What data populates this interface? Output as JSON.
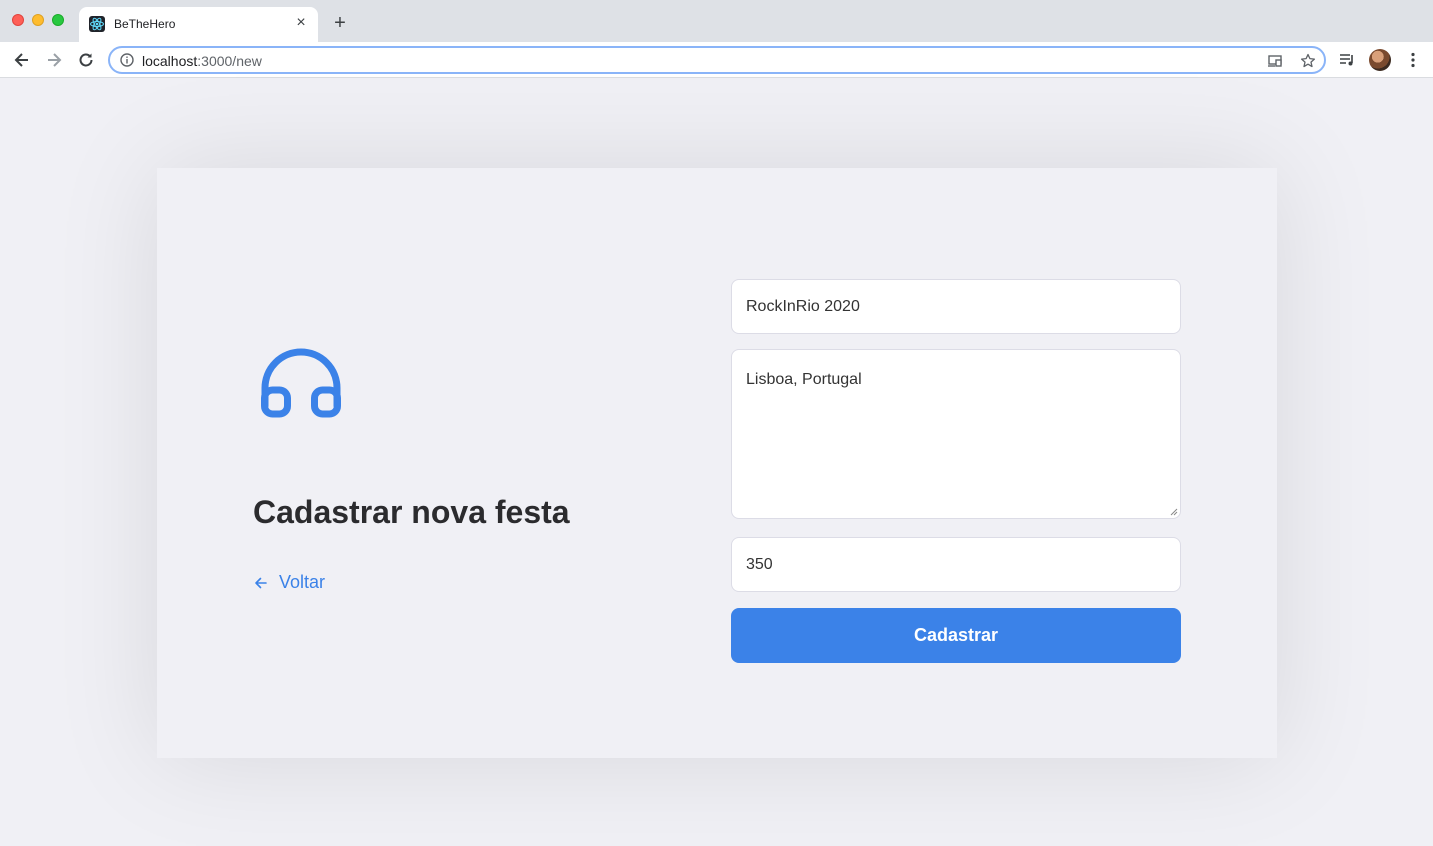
{
  "browser": {
    "tab_title": "BeTheHero",
    "tab_close": "×",
    "new_tab": "+",
    "url_host": "localhost",
    "url_path": ":3000/new",
    "icons": {
      "back": "back-arrow-icon",
      "forward": "forward-arrow-icon",
      "reload": "reload-icon",
      "info": "info-icon",
      "cast": "cast-icon",
      "bookmark": "star-icon",
      "media": "media-queue-icon",
      "menu": "kebab-menu-icon"
    }
  },
  "page": {
    "title": "Cadastrar nova festa",
    "back_label": "Voltar",
    "logo_icon": "headphones-icon",
    "accent_color": "#3b82e8",
    "form": {
      "name_value": "RockInRio 2020",
      "description_value": "Lisboa, Portugal",
      "value_value": "350",
      "submit_label": "Cadastrar"
    }
  }
}
